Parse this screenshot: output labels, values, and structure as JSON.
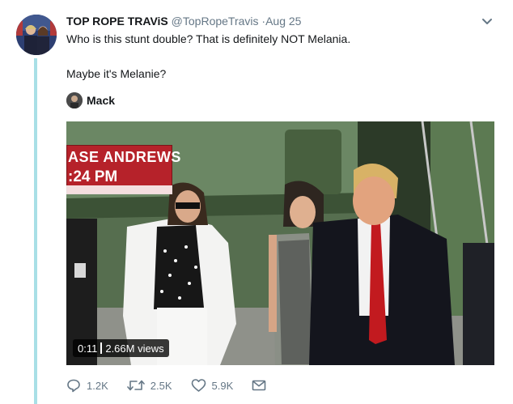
{
  "tweet": {
    "display_name": "TOP ROPE TRAViS",
    "handle": "@TopRopeTravis",
    "separator": "·",
    "date": "Aug 25",
    "text_line1": "Who is this stunt double? That is definitely NOT Melania.",
    "text_line2": "Maybe it's Melanie?",
    "mention_name": "Mack",
    "menu_icon": "chevron-down-icon",
    "thread_color": "#a8dfe6"
  },
  "video": {
    "lower_third_name": "ASE ANDREWS",
    "lower_third_time": ":24 PM",
    "elapsed": "0:11",
    "views": "2.66M views",
    "lower_third_color": "#b6222a"
  },
  "actions": {
    "reply_icon": "reply-icon",
    "reply_count": "1.2K",
    "retweet_icon": "retweet-icon",
    "retweet_count": "2.5K",
    "like_icon": "heart-icon",
    "like_count": "5.9K",
    "dm_icon": "envelope-icon",
    "icon_color": "#657786"
  }
}
